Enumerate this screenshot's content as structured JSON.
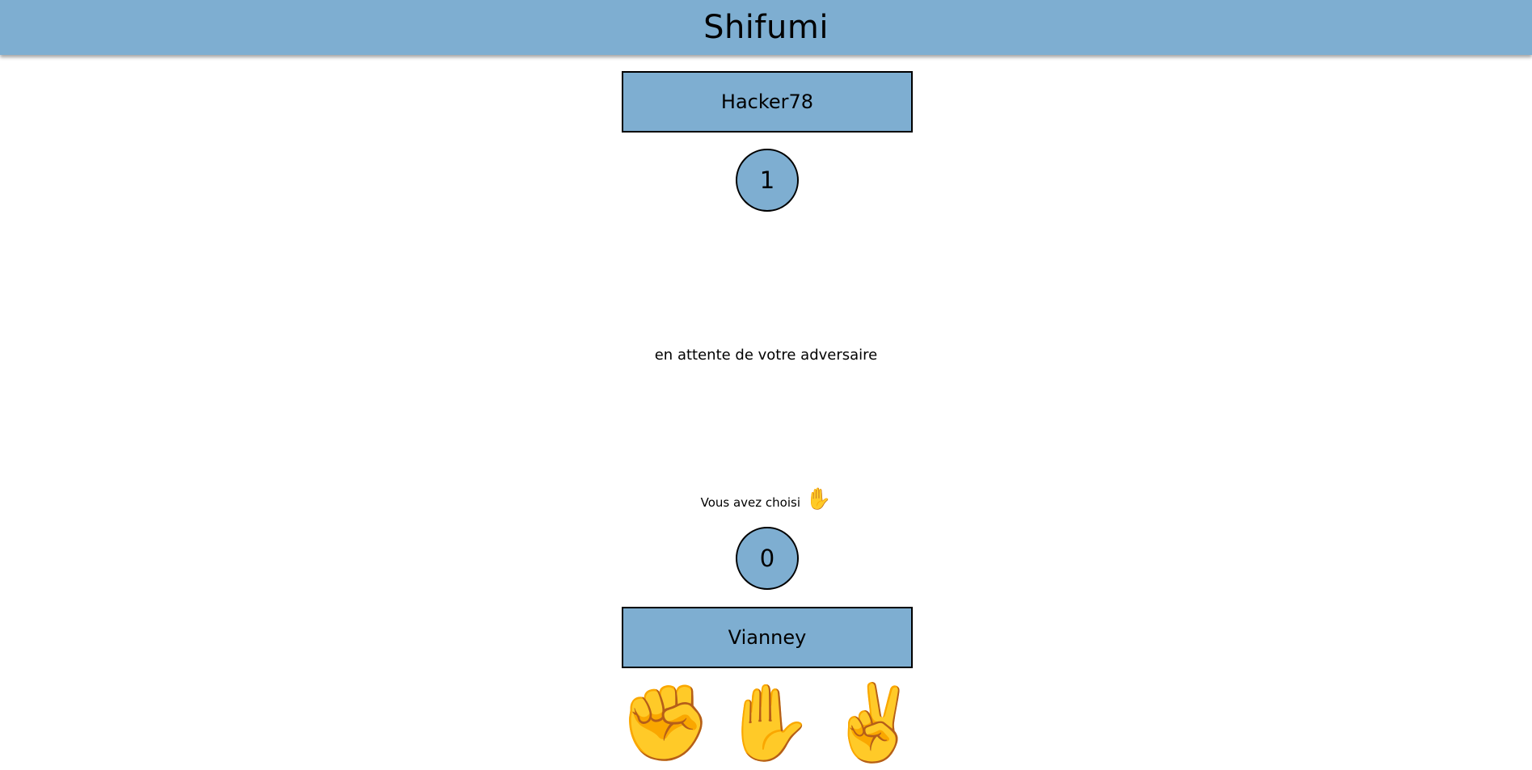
{
  "app": {
    "title": "Shifumi"
  },
  "opponent": {
    "name": "Hacker78",
    "score": "1"
  },
  "status": {
    "waiting_text": "en attente de votre adversaire"
  },
  "player": {
    "chosen_label": "Vous avez choisi",
    "chosen_emoji": "✋",
    "score": "0",
    "name": "Vianney"
  },
  "choices": [
    {
      "id": "rock",
      "emoji": "✊"
    },
    {
      "id": "paper",
      "emoji": "✋"
    },
    {
      "id": "scissors",
      "emoji": "✌️"
    }
  ],
  "colors": {
    "accent": "#7eaed1",
    "border": "#000000",
    "background": "#ffffff"
  }
}
